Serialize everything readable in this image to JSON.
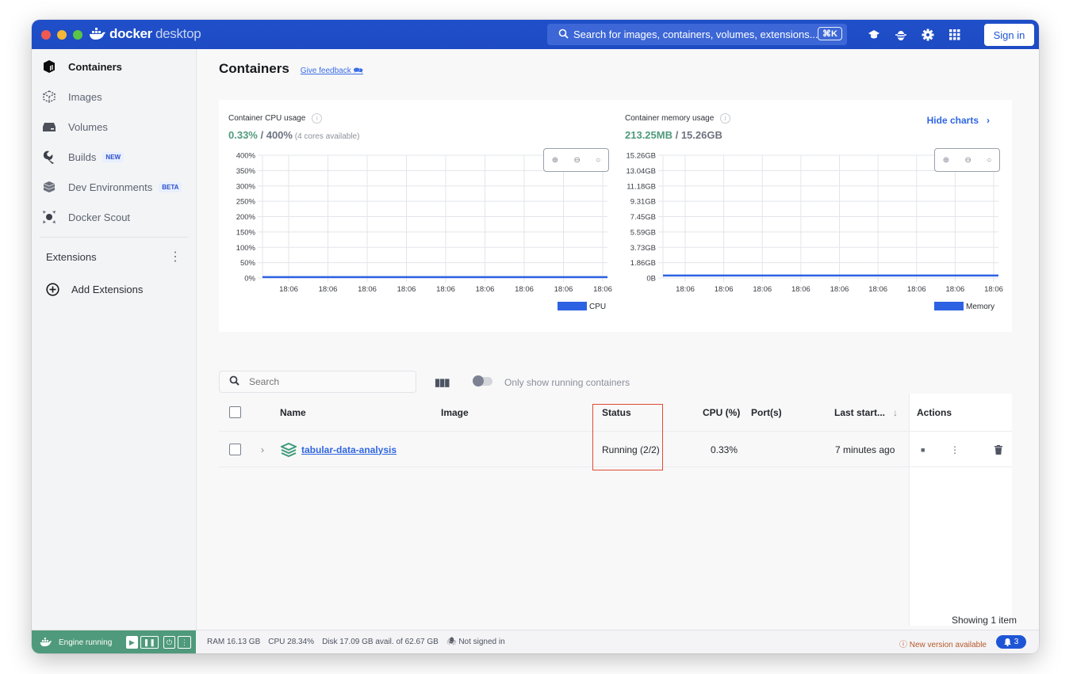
{
  "app": {
    "brand_bold": "docker",
    "brand_light": "desktop"
  },
  "topbar": {
    "search_placeholder": "Search for images, containers, volumes, extensions...",
    "search_shortcut": "⌘K",
    "icons": [
      "learning-center-icon",
      "troubleshoot-bug-icon",
      "settings-gear-icon",
      "apps-grid-icon"
    ],
    "sign_in": "Sign in"
  },
  "sidebar": {
    "items": [
      {
        "label": "Containers",
        "icon": "containers-icon",
        "active": true,
        "badge": ""
      },
      {
        "label": "Images",
        "icon": "images-icon",
        "active": false,
        "badge": ""
      },
      {
        "label": "Volumes",
        "icon": "volumes-icon",
        "active": false,
        "badge": ""
      },
      {
        "label": "Builds",
        "icon": "builds-wrench-icon",
        "active": false,
        "badge": "NEW"
      },
      {
        "label": "Dev Environments",
        "icon": "dev-environments-icon",
        "active": false,
        "badge": "BETA"
      },
      {
        "label": "Docker Scout",
        "icon": "docker-scout-icon",
        "active": false,
        "badge": ""
      }
    ],
    "extensions_label": "Extensions",
    "add_extensions": "Add Extensions"
  },
  "main": {
    "title": "Containers",
    "feedback": "Give feedback",
    "hide_charts": "Hide charts",
    "cpu": {
      "label": "Container CPU usage",
      "value": "0.33%",
      "total": " / 400%",
      "note": " (4 cores available)"
    },
    "memory": {
      "label": "Container memory usage",
      "value": "213.25MB",
      "total": " / 15.26GB"
    },
    "search_placeholder": "Search",
    "only_running_label": "Only show running containers",
    "table": {
      "headers": {
        "name": "Name",
        "image": "Image",
        "status": "Status",
        "cpu": "CPU (%)",
        "ports": "Port(s)",
        "last_started": "Last start...",
        "actions": "Actions"
      },
      "rows": [
        {
          "name": "tabular-data-analysis",
          "image": "",
          "status": "Running (2/2)",
          "cpu": "0.33%",
          "ports": "",
          "last_started": "7 minutes ago"
        }
      ]
    },
    "showing": "Showing 1 item"
  },
  "chart_data": [
    {
      "type": "line",
      "title": "Container CPU usage",
      "x": [
        "18:06",
        "18:06",
        "18:06",
        "18:06",
        "18:06",
        "18:06",
        "18:06",
        "18:06",
        "18:06"
      ],
      "yticks": [
        "0%",
        "50%",
        "100%",
        "150%",
        "200%",
        "250%",
        "300%",
        "350%",
        "400%"
      ],
      "ylim": [
        0,
        400
      ],
      "series": [
        {
          "name": "CPU",
          "values": [
            0.33,
            0.33,
            0.33,
            0.33,
            0.33,
            0.33,
            0.33,
            0.33,
            0.33,
            0.33
          ],
          "color": "#2d62e3"
        }
      ],
      "legend": "bottom-right",
      "grid": true
    },
    {
      "type": "line",
      "title": "Container memory usage",
      "x": [
        "18:06",
        "18:06",
        "18:06",
        "18:06",
        "18:06",
        "18:06",
        "18:06",
        "18:06",
        "18:06"
      ],
      "yticks": [
        "0B",
        "1.86GB",
        "3.73GB",
        "5.59GB",
        "7.45GB",
        "9.31GB",
        "11.18GB",
        "13.04GB",
        "15.26GB"
      ],
      "ylim": [
        0,
        15.26
      ],
      "series": [
        {
          "name": "Memory",
          "values": [
            0.21,
            0.21,
            0.21,
            0.21,
            0.21,
            0.21,
            0.21,
            0.21,
            0.21,
            0.21
          ],
          "color": "#2d62e3"
        }
      ],
      "legend": "bottom-right",
      "grid": true
    }
  ],
  "footer": {
    "engine_status": "Engine running",
    "ram": "RAM 16.13 GB",
    "cpu": "CPU 28.34%",
    "disk": "Disk 17.09 GB avail. of 62.67 GB",
    "signed": "Not signed in",
    "new_version": "New version available",
    "notifications": "3"
  },
  "colors": {
    "brand_blue": "#1e4bc4",
    "accent_green": "#4f9a7c",
    "link_blue": "#2f66e0",
    "status_outline": "#e04a35",
    "warning": "#b7582b"
  }
}
